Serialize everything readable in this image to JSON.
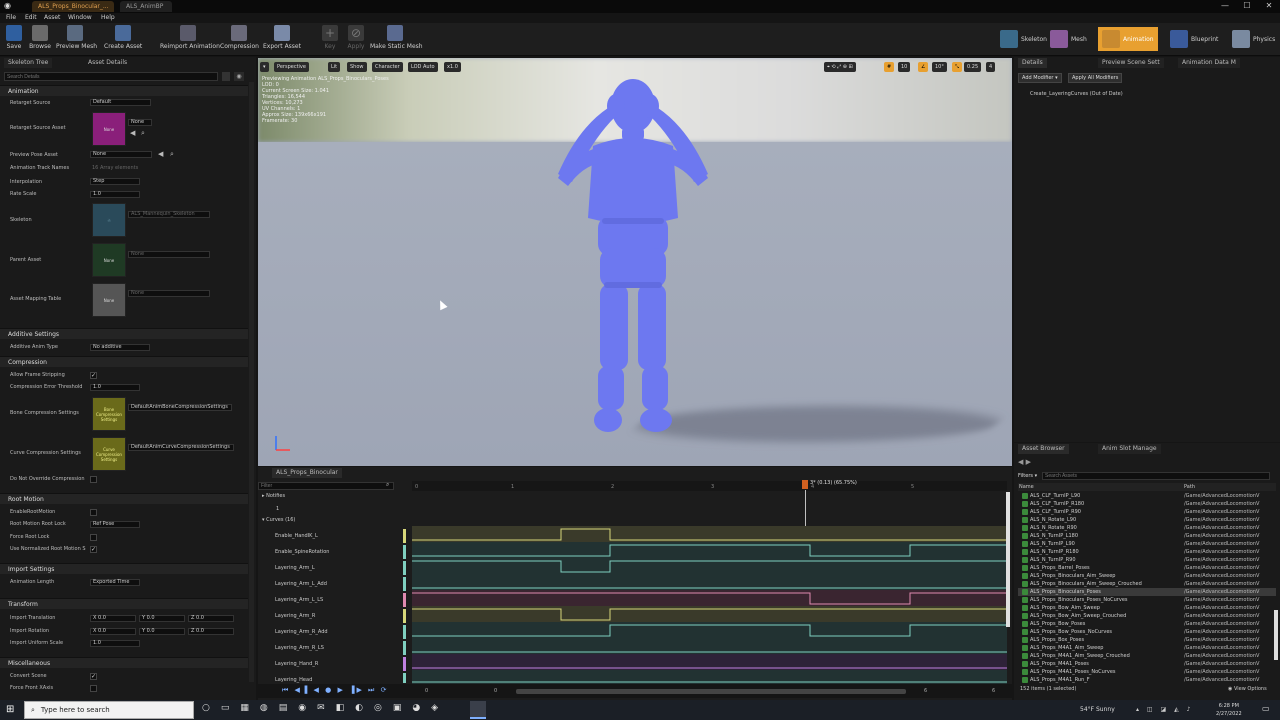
{
  "window": {
    "tabs": [
      "ALS_Props_Binocular_...",
      "ALS_AnimBP"
    ],
    "controls": [
      "—",
      "☐",
      "✕"
    ]
  },
  "menu": [
    "File",
    "Edit",
    "Asset",
    "Window",
    "Help"
  ],
  "toolbar": [
    {
      "label": "Save",
      "icon": "save-icon"
    },
    {
      "label": "Browse",
      "icon": "browse-icon"
    },
    {
      "label": "Preview Mesh",
      "icon": "preview-mesh-icon"
    },
    {
      "label": "Create Asset",
      "icon": "create-asset-icon"
    },
    {
      "label": "Reimport Animation",
      "icon": "reimport-icon"
    },
    {
      "label": "Compression",
      "icon": "compression-icon"
    },
    {
      "label": "Export Asset",
      "icon": "export-icon"
    },
    {
      "label": "Key",
      "icon": "key-icon"
    },
    {
      "label": "Apply",
      "icon": "apply-icon"
    },
    {
      "label": "Make Static Mesh",
      "icon": "static-mesh-icon"
    }
  ],
  "modes": [
    "Skeleton",
    "Mesh",
    "Animation",
    "Blueprint",
    "Physics"
  ],
  "left_panel": {
    "tabs": [
      "Skeleton Tree",
      "Asset Details"
    ],
    "search_placeholder": "Search Details",
    "sections": {
      "animation": "Animation",
      "additive": "Additive Settings",
      "compression": "Compression",
      "root_motion": "Root Motion",
      "import": "Import Settings",
      "transform": "Transform",
      "misc": "Miscellaneous"
    },
    "retarget_source": {
      "label": "Retarget Source",
      "value": "Default"
    },
    "retarget_source_asset": {
      "label": "Retarget Source Asset",
      "value": "None",
      "thumb": "None"
    },
    "preview_pose": {
      "label": "Preview Pose Asset",
      "value": "None"
    },
    "track_names": {
      "label": "Animation Track Names",
      "value": "16 Array elements"
    },
    "interpolation": {
      "label": "Interpolation",
      "value": "Step"
    },
    "rate_scale": {
      "label": "Rate Scale",
      "value": "1.0"
    },
    "skeleton": {
      "label": "Skeleton",
      "value": "ALS_Mannequin_Skeleton"
    },
    "parent_asset": {
      "label": "Parent Asset",
      "value": "None",
      "thumb": "None"
    },
    "mapping_table": {
      "label": "Asset Mapping Table",
      "value": "None",
      "thumb": "None"
    },
    "additive_type": {
      "label": "Additive Anim Type",
      "value": "No additive"
    },
    "allow_stripping": {
      "label": "Allow Frame Stripping"
    },
    "error_threshold": {
      "label": "Compression Error Threshold",
      "value": "1.0"
    },
    "bone_compression": {
      "label": "Bone Compression Settings",
      "value": "DefaultAnimBoneCompressionSettings",
      "thumb": "Bone Compression Settings"
    },
    "curve_compression": {
      "label": "Curve Compression Settings",
      "value": "DefaultAnimCurveCompressionSettings",
      "thumb": "Curve Compression Settings"
    },
    "no_override": {
      "label": "Do Not Override Compression"
    },
    "enable_root": {
      "label": "EnableRootMotion"
    },
    "root_lock": {
      "label": "Root Motion Root Lock",
      "value": "Ref Pose"
    },
    "force_root_lock": {
      "label": "Force Root Lock"
    },
    "normalized_root": {
      "label": "Use Normalized Root Motion S"
    },
    "anim_length": {
      "label": "Animation Length",
      "value": "Exported Time"
    },
    "import_translation": {
      "label": "Import Translation",
      "x": "X 0.0",
      "y": "Y 0.0",
      "z": "Z 0.0"
    },
    "import_rotation": {
      "label": "Import Rotation",
      "x": "X 0.0",
      "y": "Y 0.0",
      "z": "Z 0.0"
    },
    "import_scale": {
      "label": "Import Uniform Scale",
      "value": "1.0"
    },
    "convert_scene": {
      "label": "Convert Scene"
    },
    "force_front": {
      "label": "Force Front XAxis"
    }
  },
  "viewport": {
    "buttons": [
      "Perspective",
      "Lit",
      "Show",
      "Character",
      "LOD Auto",
      "x1.0"
    ],
    "right_values": [
      "10",
      "10°",
      "0.25",
      "4"
    ],
    "info": [
      "Previewing Animation ALS_Props_Binoculars_Poses",
      "LOD: 0",
      "Current Screen Size: 1.041",
      "Triangles: 16,544",
      "Vertices: 10,273",
      "UV Channels: 1",
      "Approx Size: 139x66x191",
      "Framerate: 30"
    ]
  },
  "timeline": {
    "tab": "ALS_Props_Binocular",
    "filter_placeholder": "Filter",
    "notifies": "Notifies",
    "notify_row": "1",
    "curves_header": "Curves",
    "curves_count": "(16)",
    "playhead": "3* (0.13) (65.75%)",
    "ruler": [
      "0",
      "1",
      "2",
      "3",
      "4",
      "5"
    ],
    "curves": [
      {
        "name": "Enable_HandIK_L",
        "color": "#d7d77a"
      },
      {
        "name": "Enable_SpineRotation",
        "color": "#7fd0c0"
      },
      {
        "name": "Layering_Arm_L",
        "color": "#7fd0c0"
      },
      {
        "name": "Layering_Arm_L_Add",
        "color": "#7fd0c0"
      },
      {
        "name": "Layering_Arm_L_LS",
        "color": "#e08ab0"
      },
      {
        "name": "Layering_Arm_R",
        "color": "#d7d77a"
      },
      {
        "name": "Layering_Arm_R_Add",
        "color": "#7fd0c0"
      },
      {
        "name": "Layering_Arm_R_LS",
        "color": "#7fd0c0"
      },
      {
        "name": "Layering_Hand_R",
        "color": "#c080e0"
      },
      {
        "name": "Layering_Head",
        "color": "#7fd0c0"
      }
    ],
    "transport_values": [
      "0",
      "0",
      "6",
      "6"
    ]
  },
  "right_panel": {
    "tabs": [
      "Details",
      "Preview Scene Sett",
      "Animation Data M"
    ],
    "buttons": [
      "Add Modifier",
      "Apply All Modifiers"
    ],
    "modifier": "Create_LayeringCurves (Out of Date)"
  },
  "asset_browser": {
    "tabs": [
      "Asset Browser",
      "Anim Slot Manage"
    ],
    "filters": "Filters",
    "search_placeholder": "Search Assets",
    "columns": [
      "Name",
      "Path"
    ],
    "items": [
      {
        "name": "ALS_CLF_TurnIP_L90",
        "path": "/Game/AdvancedLocomotionV"
      },
      {
        "name": "ALS_CLF_TurnIP_R180",
        "path": "/Game/AdvancedLocomotionV"
      },
      {
        "name": "ALS_CLF_TurnIP_R90",
        "path": "/Game/AdvancedLocomotionV"
      },
      {
        "name": "ALS_N_Rotate_L90",
        "path": "/Game/AdvancedLocomotionV"
      },
      {
        "name": "ALS_N_Rotate_R90",
        "path": "/Game/AdvancedLocomotionV"
      },
      {
        "name": "ALS_N_TurnIP_L180",
        "path": "/Game/AdvancedLocomotionV"
      },
      {
        "name": "ALS_N_TurnIP_L90",
        "path": "/Game/AdvancedLocomotionV"
      },
      {
        "name": "ALS_N_TurnIP_R180",
        "path": "/Game/AdvancedLocomotionV"
      },
      {
        "name": "ALS_N_TurnIP_R90",
        "path": "/Game/AdvancedLocomotionV"
      },
      {
        "name": "ALS_Props_Barrel_Poses",
        "path": "/Game/AdvancedLocomotionV"
      },
      {
        "name": "ALS_Props_Binoculars_Aim_Sweep",
        "path": "/Game/AdvancedLocomotionV"
      },
      {
        "name": "ALS_Props_Binoculars_Aim_Sweep_Crouched",
        "path": "/Game/AdvancedLocomotionV"
      },
      {
        "name": "ALS_Props_Binoculars_Poses",
        "path": "/Game/AdvancedLocomotionV"
      },
      {
        "name": "ALS_Props_Binoculars_Poses_NoCurves",
        "path": "/Game/AdvancedLocomotionV"
      },
      {
        "name": "ALS_Props_Bow_Aim_Sweep",
        "path": "/Game/AdvancedLocomotionV"
      },
      {
        "name": "ALS_Props_Bow_Aim_Sweep_Crouched",
        "path": "/Game/AdvancedLocomotionV"
      },
      {
        "name": "ALS_Props_Bow_Poses",
        "path": "/Game/AdvancedLocomotionV"
      },
      {
        "name": "ALS_Props_Bow_Poses_NoCurves",
        "path": "/Game/AdvancedLocomotionV"
      },
      {
        "name": "ALS_Props_Box_Poses",
        "path": "/Game/AdvancedLocomotionV"
      },
      {
        "name": "ALS_Props_M4A1_Aim_Sweep",
        "path": "/Game/AdvancedLocomotionV"
      },
      {
        "name": "ALS_Props_M4A1_Aim_Sweep_Crouched",
        "path": "/Game/AdvancedLocomotionV"
      },
      {
        "name": "ALS_Props_M4A1_Poses",
        "path": "/Game/AdvancedLocomotionV"
      },
      {
        "name": "ALS_Props_M4A1_Poses_NoCurves",
        "path": "/Game/AdvancedLocomotionV"
      },
      {
        "name": "ALS_Props_M4A1_Run_F",
        "path": "/Game/AdvancedLocomotionV"
      }
    ],
    "status": "152 items (1 selected)",
    "view_options": "View Options"
  },
  "taskbar": {
    "search_placeholder": "Type here to search",
    "weather": "54°F Sunny",
    "time": "6:28 PM",
    "date": "2/27/2022"
  }
}
